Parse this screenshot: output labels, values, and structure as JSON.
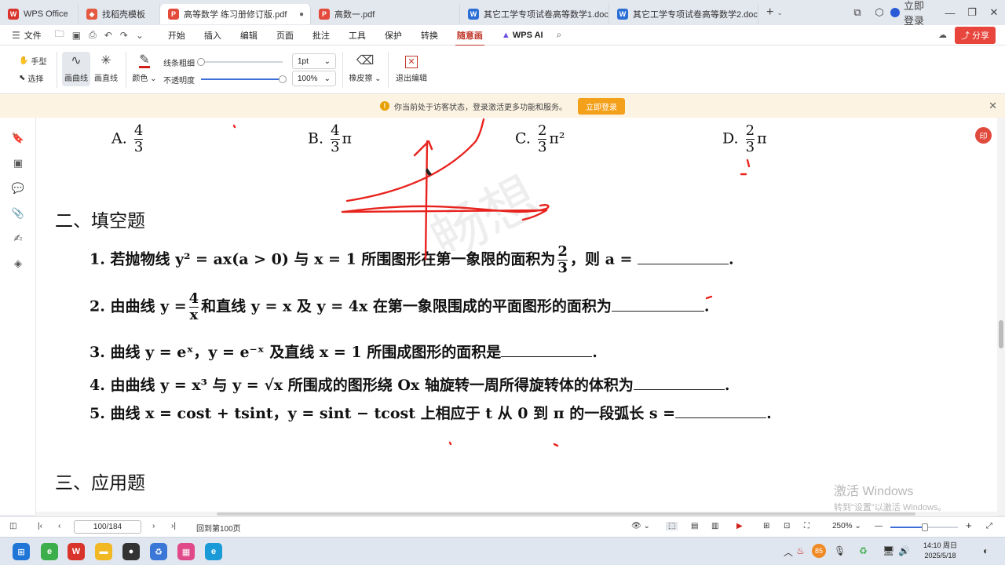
{
  "tabs": [
    {
      "label": "WPS Office",
      "icon": "wps-logo-icon"
    },
    {
      "label": "找稻壳模板",
      "icon": "template-icon"
    },
    {
      "label": "高等数学 练习册修订版.pdf",
      "icon": "pdf-icon",
      "active": true
    },
    {
      "label": "高数一.pdf",
      "icon": "pdf-icon"
    },
    {
      "label": "其它工学专项试卷高等数学1.doc",
      "icon": "word-icon"
    },
    {
      "label": "其它工学专项试卷高等数学2.doc",
      "icon": "word-icon"
    }
  ],
  "window": {
    "login_label": "立即登录"
  },
  "menu": {
    "file": "文件",
    "items": [
      "开始",
      "插入",
      "编辑",
      "页面",
      "批注",
      "工具",
      "保护",
      "转换",
      "随意画"
    ],
    "active_index": 8,
    "ai_label": "WPS AI",
    "share_label": "分享"
  },
  "toolbar": {
    "hand": "手型",
    "select": "选择",
    "draw_line": "画曲线",
    "straight_line": "画直线",
    "color": "颜色",
    "stroke_width_label": "线条粗细",
    "stroke_width_value": "1pt",
    "opacity_label": "不透明度",
    "opacity_value": "100%",
    "eraser": "橡皮擦",
    "exit": "退出编辑",
    "stroke_level": 0.0,
    "opacity_level": 1.0
  },
  "notice": {
    "text": "你当前处于访客状态，登录激活更多功能和服务。",
    "button": "立即登录"
  },
  "document": {
    "options": [
      {
        "label": "A.",
        "num": "4",
        "den": "3",
        "suffix": ""
      },
      {
        "label": "B.",
        "num": "4",
        "den": "3",
        "suffix": "π"
      },
      {
        "label": "C.",
        "num": "2",
        "den": "3",
        "suffix": "π²"
      },
      {
        "label": "D.",
        "num": "2",
        "den": "3",
        "suffix": "π"
      }
    ],
    "section2": "二、填空题",
    "q1_a": "1. 若抛物线 y² = ax(a > 0) 与 x = 1 所围图形在第一象限的面积为",
    "q1_num": "2",
    "q1_den": "3",
    "q1_b": "，则 a =",
    "q2_a": "2. 由曲线 y =",
    "q2_num": "4",
    "q2_den": "x",
    "q2_b": "和直线 y = x 及 y = 4x 在第一象限围成的平面图形的面积为",
    "q3": "3. 曲线 y = eˣ，y = e⁻ˣ 及直线 x = 1 所围成图形的面积是",
    "q4": "4. 由曲线 y = x³ 与 y = √x 所围成的图形绕 Ox 轴旋转一周所得旋转体的体积为",
    "q5": "5. 曲线 x = cost + tsint，y = sint − tcost 上相应于 t 从 0 到 π 的一段弧长 s =",
    "section3": "三、应用题",
    "badge": "印",
    "ink_color": "#e8231e"
  },
  "watermark": {
    "line1": "激活 Windows",
    "line2": "转到\"设置\"以激活 Windows。"
  },
  "status": {
    "page_value": "100/184",
    "back_label": "回到第100页",
    "zoom": "250%"
  },
  "clock": {
    "time": "14:10 周日",
    "date": "2025/5/18"
  },
  "tray": {
    "badge": "85"
  }
}
